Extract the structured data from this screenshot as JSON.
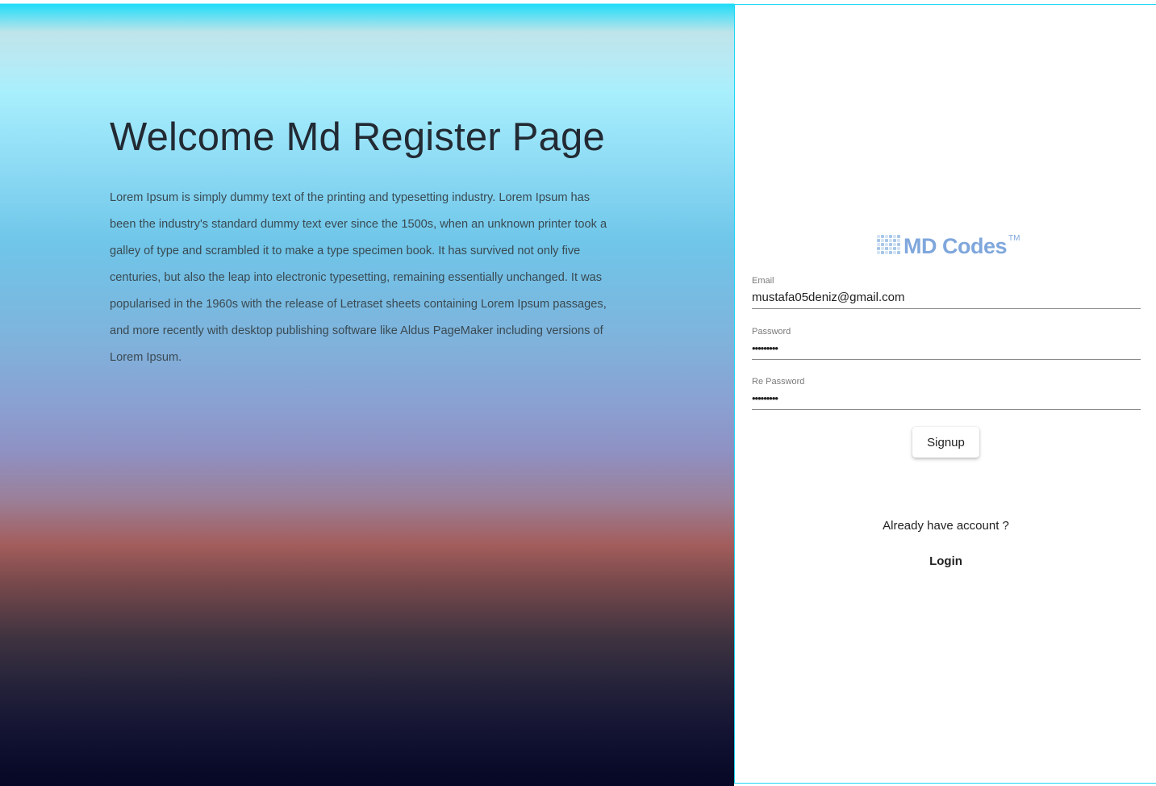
{
  "hero": {
    "title": "Welcome Md Register Page",
    "description": "Lorem Ipsum is simply dummy text of the printing and typesetting industry. Lorem Ipsum has been the industry's standard dummy text ever since the 1500s, when an unknown printer took a galley of type and scrambled it to make a type specimen book. It has survived not only five centuries, but also the leap into electronic typesetting, remaining essentially unchanged. It was popularised in the 1960s with the release of Letraset sheets containing Lorem Ipsum passages, and more recently with desktop publishing software like Aldus PageMaker including versions of Lorem Ipsum."
  },
  "logo": {
    "text": "MD Codes",
    "trademark": "TM"
  },
  "form": {
    "email": {
      "label": "Email",
      "value": "mustafa05deniz@gmail.com"
    },
    "password": {
      "label": "Password",
      "value": "•••••••••"
    },
    "re_password": {
      "label": "Re Password",
      "value": "•••••••••"
    },
    "signup_label": "Signup"
  },
  "footer": {
    "already_text": "Already have account ?",
    "login_label": "Login"
  },
  "colors": {
    "panel_border": "#20d6f5",
    "logo": "#7fa7dc"
  }
}
